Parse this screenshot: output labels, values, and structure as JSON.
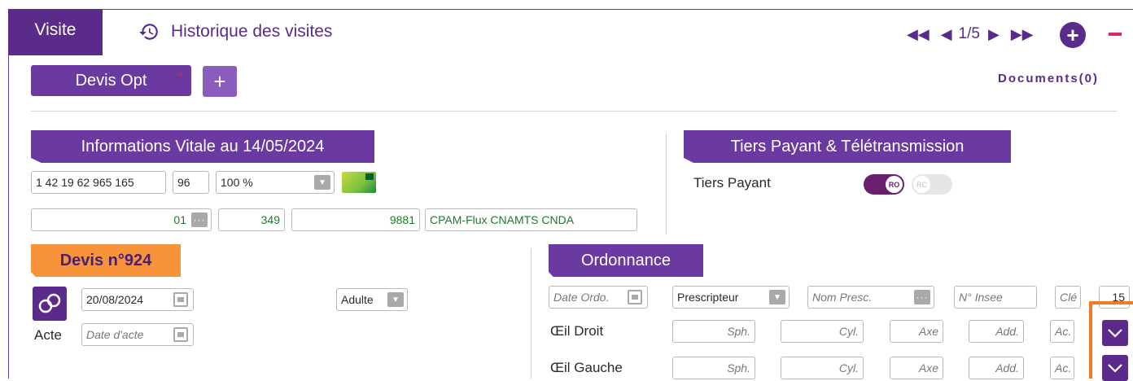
{
  "tabs": {
    "visite": "Visite",
    "historique": "Historique des visites"
  },
  "pagination": {
    "counter": "1/5"
  },
  "devis_tab": {
    "label": "Devis Opt",
    "close": "×",
    "add": "+"
  },
  "documents": "Documents(0)",
  "vitale": {
    "title": "Informations Vitale au 14/05/2024",
    "nir": "1 42 19 62 965 165",
    "rang": "96",
    "taux": "100 %",
    "regime": "01",
    "caisse": "349",
    "centre": "9881",
    "organisme": "CPAM-Flux CNAMTS CNDA"
  },
  "tiers": {
    "title": "Tiers Payant & Télétransmission",
    "label": "Tiers Payant",
    "ro": "RO",
    "rc": "RC"
  },
  "devis": {
    "title": "Devis n°924",
    "date": "20/08/2024",
    "type": "Adulte",
    "acte_label": "Acte",
    "date_acte_placeholder": "Date d'acte"
  },
  "ordonnance": {
    "title": "Ordonnance",
    "date_placeholder": "Date Ordo.",
    "prescripteur": "Prescripteur",
    "nom_presc_placeholder": "Nom Presc.",
    "insee_placeholder": "N° Insee",
    "cle_placeholder": "Clé",
    "num": "15",
    "oeil_droit": "Œil Droit",
    "oeil_gauche": "Œil Gauche",
    "sph": "Sph.",
    "cyl": "Cyl.",
    "axe": "Axe",
    "add": "Add.",
    "ac": "Ac."
  },
  "colors": {
    "accent": "#6a3aa0",
    "orange": "#f7943b",
    "remove": "#e0245e",
    "highlight": "#f07a25"
  }
}
